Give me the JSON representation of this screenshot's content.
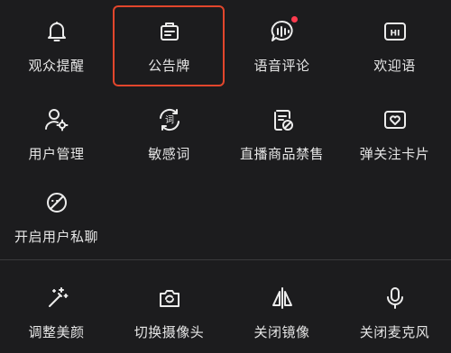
{
  "grid": {
    "row1": [
      "观众提醒",
      "公告牌",
      "语音评论",
      "欢迎语"
    ],
    "row2": [
      "用户管理",
      "敏感词",
      "直播商品禁售",
      "弹关注卡片"
    ],
    "row3": [
      "开启用户私聊"
    ]
  },
  "bottom": [
    "调整美颜",
    "切换摄像头",
    "关闭镜像",
    "关闭麦克风"
  ],
  "icons": {
    "hi": "HI",
    "word": "词"
  },
  "colors": {
    "background": "#1c1c1e",
    "highlight": "#e2462c",
    "notification_dot": "#ff3b4e"
  }
}
